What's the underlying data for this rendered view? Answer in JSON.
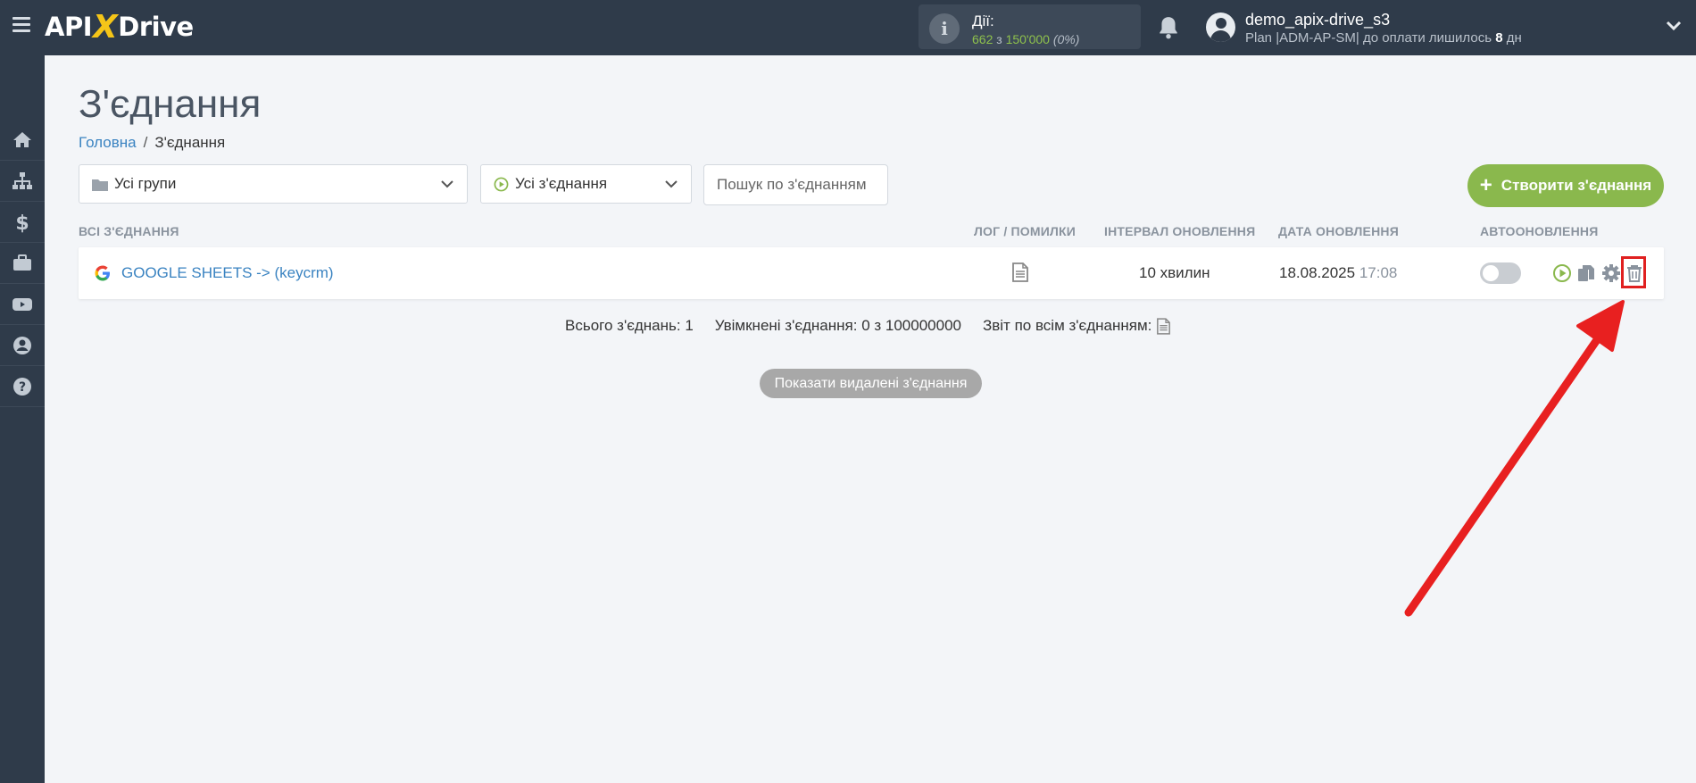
{
  "header": {
    "logo_text_1": "API",
    "logo_text_x": "X",
    "logo_text_2": "Drive",
    "actions_label": "Дії:",
    "actions_used": "662",
    "actions_sep": "з",
    "actions_total": "150'000",
    "actions_percent": "(0%)",
    "user_name": "demo_apix-drive_s3",
    "user_plan_prefix": "Plan |ADM-AP-SM| до оплати лишилось",
    "user_plan_days": "8",
    "user_plan_suffix": "дн"
  },
  "sidebar": {
    "items": [
      "home-icon",
      "sitemap-icon",
      "dollar-icon",
      "briefcase-icon",
      "youtube-icon",
      "user-circle-icon",
      "help-icon"
    ]
  },
  "page": {
    "title": "З'єднання",
    "breadcrumb_home": "Головна",
    "breadcrumb_sep": "/",
    "breadcrumb_current": "З'єднання"
  },
  "filters": {
    "groups_value": "Усі групи",
    "connections_value": "Усі з'єднання",
    "search_placeholder": "Пошук по з'єднанням",
    "create_label": "Створити з'єднання",
    "create_plus": "+"
  },
  "table": {
    "headers": {
      "all": "ВСІ З'ЄДНАННЯ",
      "log": "ЛОГ / ПОМИЛКИ",
      "interval": "ІНТЕРВАЛ ОНОВЛЕННЯ",
      "date": "ДАТА ОНОВЛЕННЯ",
      "auto": "АВТООНОВЛЕННЯ"
    },
    "rows": [
      {
        "name": "GOOGLE SHEETS -> (keycrm)",
        "interval": "10 хвилин",
        "date": "18.08.2025",
        "time": "17:08",
        "auto_update": false
      }
    ]
  },
  "stats": {
    "total": "Всього з'єднань: 1",
    "enabled": "Увімкнені з'єднання: 0 з 100000000",
    "report": "Звіт по всім з'єднанням:"
  },
  "show_deleted_label": "Показати видалені з'єднання",
  "colors": {
    "topbar": "#2f3b4a",
    "accent_green": "#8ab84d",
    "link_blue": "#3a83c1",
    "highlight_red": "#e02020"
  }
}
